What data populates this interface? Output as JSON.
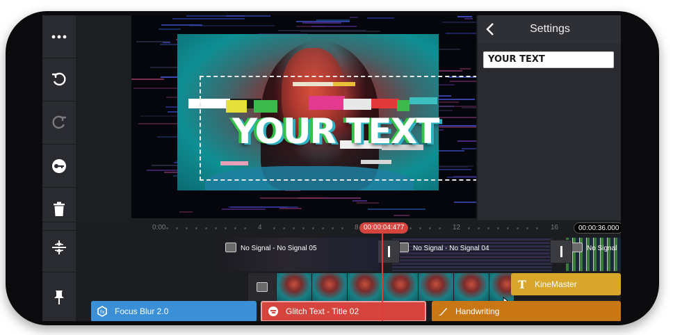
{
  "toolbar": {
    "items": [
      {
        "icon": "more-icon"
      },
      {
        "icon": "undo-icon"
      },
      {
        "icon": "redo-icon"
      },
      {
        "icon": "key-icon"
      },
      {
        "icon": "trash-icon"
      }
    ],
    "bottom_items": [
      {
        "icon": "split-icon"
      },
      {
        "icon": "pin-icon"
      }
    ]
  },
  "preview": {
    "overlay_text": "YOUR TEXT"
  },
  "settings": {
    "title": "Settings",
    "text_value": "YOUR TEXT"
  },
  "timeline": {
    "ruler_labels": [
      "0:00",
      "4",
      "8",
      "12",
      "16"
    ],
    "current_time": "00:00:04:477",
    "total_time": "00:00:36.000",
    "clips": [
      {
        "label": "No Signal - No Signal 05"
      },
      {
        "label": "No Signal - No Signal 04"
      },
      {
        "label": "No Signal"
      }
    ],
    "layers": [
      {
        "label": "KineMaster",
        "color": "#d8a62a",
        "icon": "text-t-icon"
      },
      {
        "label": "Focus Blur 2.0",
        "color": "#3a8fd6",
        "icon": "effect-icon"
      },
      {
        "label": "Glitch Text - Title 02",
        "color": "#d6453d",
        "icon": "glitch-icon"
      },
      {
        "label": "Handwriting",
        "color": "#c97614",
        "icon": "brush-icon"
      }
    ]
  },
  "colors": {
    "accent_red": "#e03a3a",
    "panel_bg": "#2a2b30",
    "frame": "#0b0b0d"
  }
}
